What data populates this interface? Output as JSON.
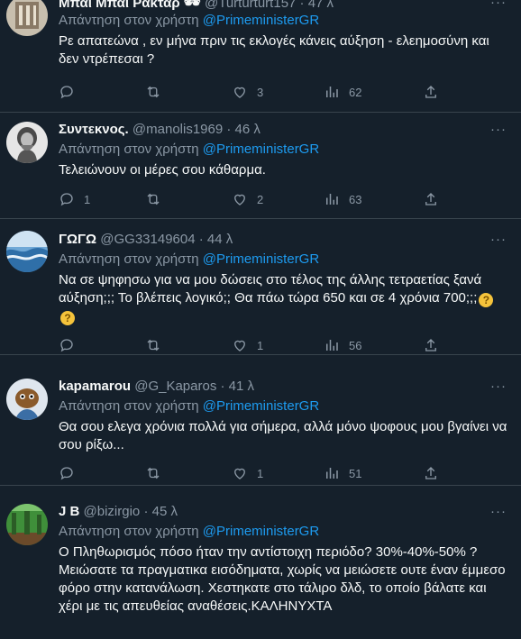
{
  "tweets": [
    {
      "name": "Μπαι Μπαι Ρακταρ 🕶",
      "handle": "@Turturturt157",
      "time": "· 47 λ",
      "reply_prefix": "Απάντηση στον χρήστη",
      "mention": "@PrimeministerGR",
      "text": "Ρε απατεώνα , εν μήνα πριν τις εκλογές κάνεις αύξηση - ελεημοσύνη και δεν ντρέπεσαι ?",
      "reply_count": "",
      "retweet_count": "",
      "like_count": "3",
      "view_count": "62"
    },
    {
      "name": "Συντεκνος.",
      "handle": "@manolis1969",
      "time": "· 46 λ",
      "reply_prefix": "Απάντηση στον χρήστη",
      "mention": "@PrimeministerGR",
      "text": "Τελειώνουν οι μέρες σου κάθαρμα.",
      "reply_count": "1",
      "retweet_count": "",
      "like_count": "2",
      "view_count": "63"
    },
    {
      "name": "ΓΩΓΩ",
      "handle": "@GG33149604",
      "time": "· 44 λ",
      "reply_prefix": "Απάντηση στον χρήστη",
      "mention": "@PrimeministerGR",
      "text": "Να σε ψηφησω για να μου δώσεις στο τέλος της άλλης τετραετίας ξανά αύξηση;;; Το βλέπεις λογικό;; Θα πάω τώρα 650 και σε 4 χρόνια 700;;;",
      "reply_count": "",
      "retweet_count": "",
      "like_count": "1",
      "view_count": "56"
    },
    {
      "name": "kapamarou",
      "handle": "@G_Kaparos",
      "time": "· 41 λ",
      "reply_prefix": "Απάντηση στον χρήστη",
      "mention": "@PrimeministerGR",
      "text": "Θα σου ελεγα χρόνια πολλά για σήμερα, αλλά μόνο ψοφους μου βγαίνει να σου ρίξω...",
      "reply_count": "",
      "retweet_count": "",
      "like_count": "1",
      "view_count": "51"
    },
    {
      "name": "J B",
      "handle": "@bizirgio",
      "time": "· 45 λ",
      "reply_prefix": "Απάντηση στον χρήστη",
      "mention": "@PrimeministerGR",
      "text": "Ο Πληθωρισμός πόσο ήταν την αντίστοιχη περιόδο? 30%-40%-50% ?Μειώσατε τα πραγματικα εισόδηματα, χωρίς να μειώσετε ουτε έναν έμμεσο φόρο στην κατανάλωση. Χεστηκατε στο τάλιρο δλδ, το οποίο βάλατε και χέρι με τις απευθείας αναθέσεις.ΚΑΛΗΝΥΧΤΑ",
      "reply_count": "",
      "retweet_count": "",
      "like_count": "",
      "view_count": ""
    }
  ],
  "more_label": "···",
  "colors": {
    "background": "#15202b",
    "accent": "#1d9bf0",
    "muted": "#8b98a5"
  }
}
